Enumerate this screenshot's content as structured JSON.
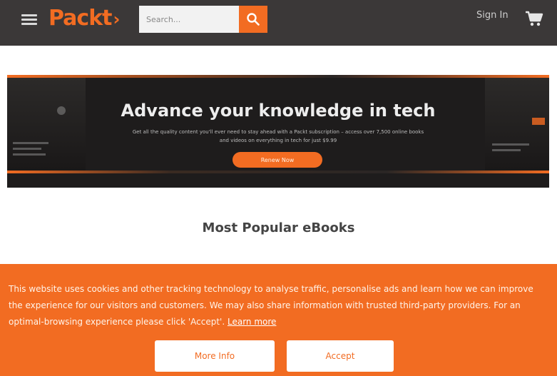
{
  "header": {
    "logo_text": "Packt",
    "search": {
      "placeholder": "Search...",
      "value": ""
    },
    "signin_label": "Sign In"
  },
  "banner": {
    "title": "Advance your knowledge in tech",
    "subtitle": "Get all the quality content you'll ever need to stay ahead with a Packt subscription – access over 7,500 online books and videos on everything in tech for just $9.99",
    "cta_label": "Renew Now"
  },
  "main": {
    "section_title": "Most Popular eBooks"
  },
  "cookie": {
    "text": "This website uses cookies and other tracking technology to analyse traffic, personalise ads and learn how we can improve the experience for our visitors and customers. We may also share information with trusted third-party providers. For an optimal-browsing experience please click 'Accept'.",
    "link_label": "Learn more",
    "more_info_label": "More Info",
    "accept_label": "Accept"
  },
  "colors": {
    "brand_orange": "#f26c22",
    "header_bg": "#3b3838",
    "banner_bg": "#1e1c1c"
  },
  "icons": [
    "hamburger-icon",
    "search-icon",
    "cart-icon"
  ]
}
